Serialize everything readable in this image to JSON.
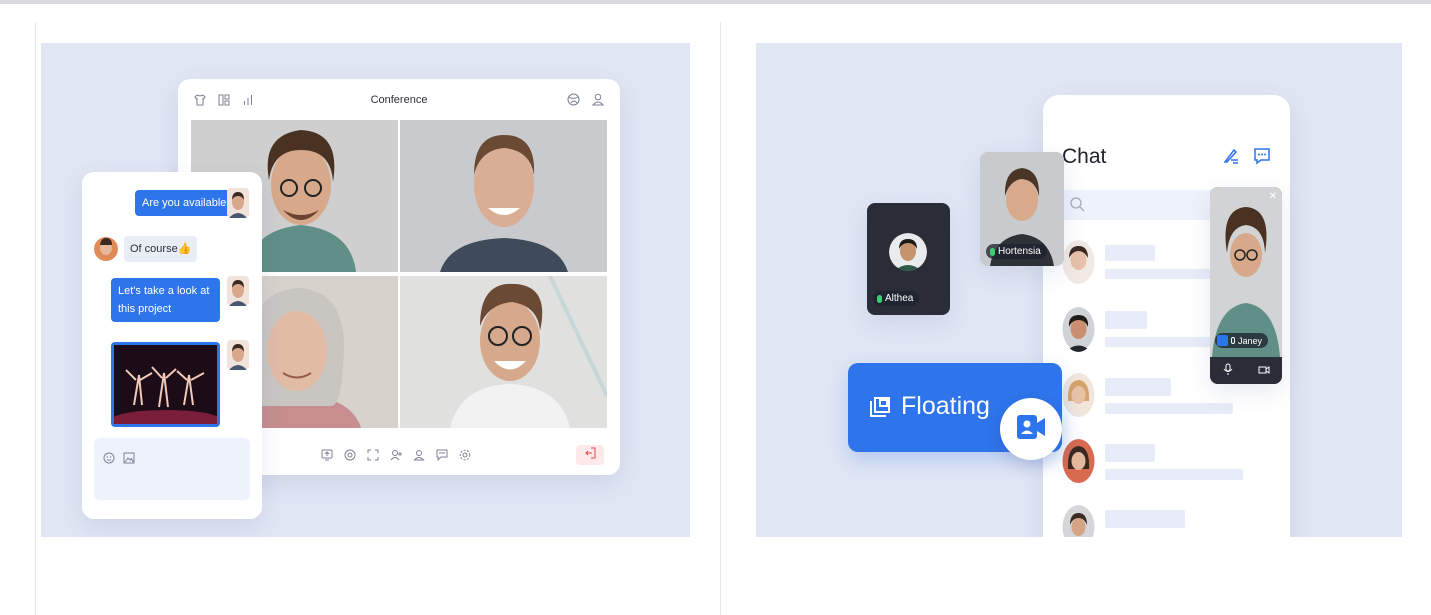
{
  "left_panel": {
    "conference": {
      "title": "Conference",
      "toolbar_icons": [
        "shirt-icon",
        "layout-icon",
        "signal-icon"
      ],
      "right_icons": [
        "globe-icon",
        "user-icon"
      ],
      "bottom_icons": [
        "share-screen-icon",
        "record-icon",
        "fullscreen-icon",
        "invite-icon",
        "members-icon",
        "chat-icon",
        "settings-icon"
      ],
      "leave_icon": "exit-icon"
    },
    "chat": {
      "messages": [
        {
          "from": "me",
          "text": "Are you available?"
        },
        {
          "from": "other",
          "text": "Of course👍"
        },
        {
          "from": "me",
          "text": "Let's take a look at this project"
        },
        {
          "from": "me",
          "type": "image"
        }
      ],
      "input_icons": [
        "emoji-icon",
        "image-icon"
      ]
    }
  },
  "right_panel": {
    "chat_title": "Chat",
    "participants": [
      {
        "name": "Althea"
      },
      {
        "name": "Hortensia"
      },
      {
        "name": "Janey"
      }
    ],
    "floating_label": "Floating",
    "colors": {
      "accent": "#2e74ea",
      "panel_bg": "#e1e6f4"
    }
  }
}
